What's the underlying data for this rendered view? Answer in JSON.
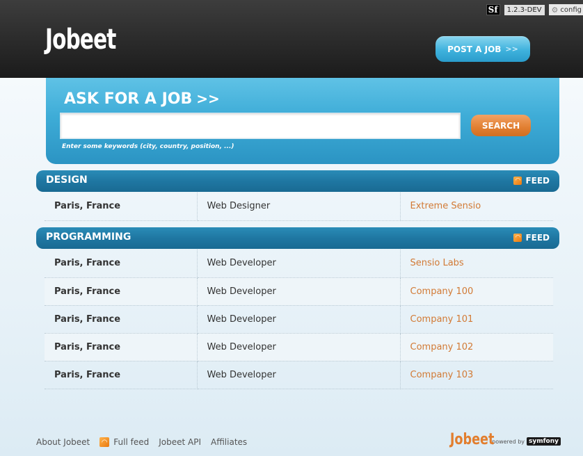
{
  "debug": {
    "sf_badge": "Sf",
    "version": "1.2.3-DEV",
    "config_label": "config"
  },
  "header": {
    "logo": "Jobeet",
    "post_job_label": "POST A JOB",
    "post_job_arrows": ">>"
  },
  "search": {
    "title": "ASK FOR A JOB",
    "title_arrows": ">>",
    "input_value": "",
    "button_label": "SEARCH",
    "help_text": "Enter some keywords (city, country, position, ...)"
  },
  "categories": [
    {
      "name": "DESIGN",
      "feed_label": "FEED",
      "jobs": [
        {
          "location": "Paris, France",
          "position": "Web Designer",
          "company": "Extreme Sensio"
        }
      ]
    },
    {
      "name": "PROGRAMMING",
      "feed_label": "FEED",
      "jobs": [
        {
          "location": "Paris, France",
          "position": "Web Developer",
          "company": "Sensio Labs"
        },
        {
          "location": "Paris, France",
          "position": "Web Developer",
          "company": "Company 100"
        },
        {
          "location": "Paris, France",
          "position": "Web Developer",
          "company": "Company 101"
        },
        {
          "location": "Paris, France",
          "position": "Web Developer",
          "company": "Company 102"
        },
        {
          "location": "Paris, France",
          "position": "Web Developer",
          "company": "Company 103"
        }
      ]
    }
  ],
  "footer": {
    "about": "About Jobeet",
    "full_feed": "Full feed",
    "api": "Jobeet API",
    "affiliates": "Affiliates",
    "powered_logo": "Jobeet",
    "powered_text": "powered by",
    "symfony": "symfony"
  },
  "colors": {
    "accent_blue": "#2b94c3",
    "accent_orange": "#e17f31",
    "company_link": "#d27a35"
  }
}
